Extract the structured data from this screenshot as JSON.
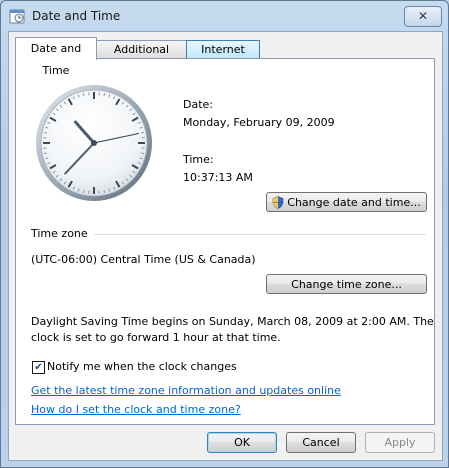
{
  "window": {
    "title": "Date and Time",
    "close_label": "✕"
  },
  "tabs": [
    {
      "label": "Date and Time",
      "active": true
    },
    {
      "label": "Additional Clocks",
      "active": false
    },
    {
      "label": "Internet Time",
      "active": false
    }
  ],
  "datetime": {
    "date_label": "Date:",
    "date_value": "Monday, February 09, 2009",
    "time_label": "Time:",
    "time_value": "10:37:13 AM",
    "change_button": "Change date and time...",
    "clock": {
      "hour": 10,
      "minute": 37,
      "second": 13
    }
  },
  "timezone": {
    "header": "Time zone",
    "value": "(UTC-06:00) Central Time (US & Canada)",
    "change_button": "Change time zone..."
  },
  "dst": {
    "line1": "Daylight Saving Time begins on Sunday, March 08, 2009 at 2:00 AM. The",
    "line2": "clock is set to go forward 1 hour at that time."
  },
  "notify": {
    "label": "Notify me when the clock changes",
    "checked": true,
    "check_glyph": "✔"
  },
  "links": {
    "latest_info": "Get the latest time zone information and updates online",
    "how_to": "How do I set the clock and time zone?"
  },
  "footer": {
    "ok": "OK",
    "cancel": "Cancel",
    "apply": "Apply"
  },
  "colors": {
    "link": "#0066cc",
    "window_frame": "#b8cde3"
  }
}
